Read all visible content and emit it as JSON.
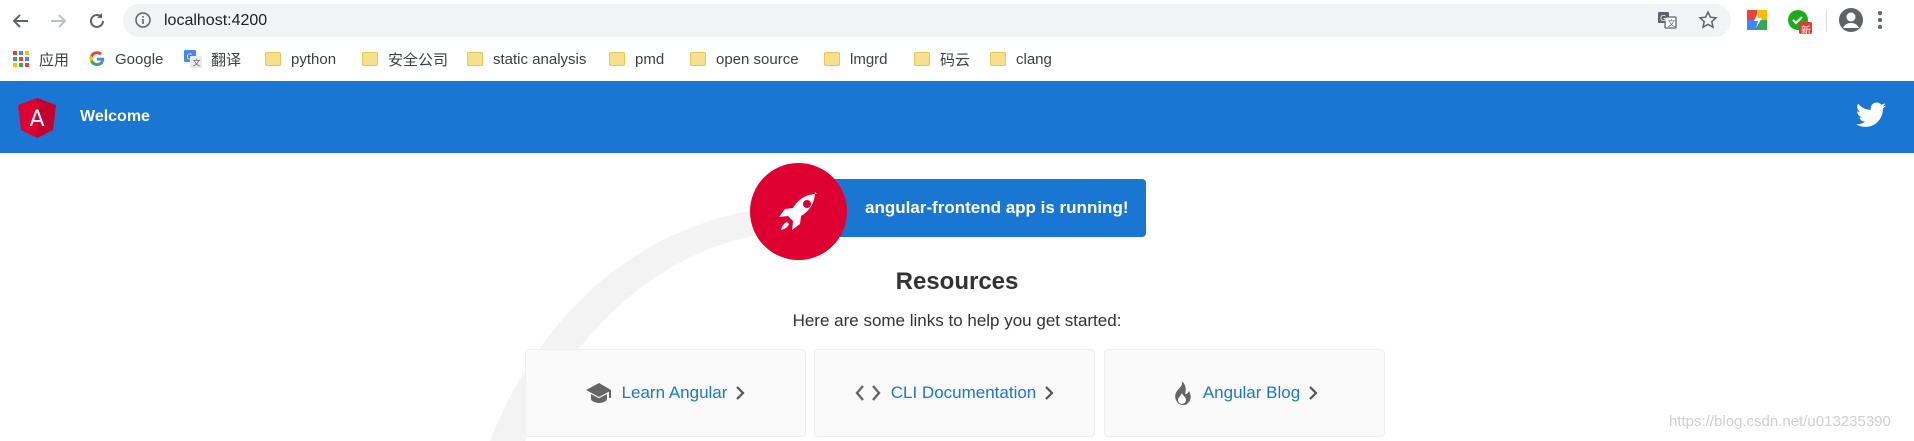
{
  "browser": {
    "url": "localhost:4200",
    "bookmarks": [
      {
        "label": "应用",
        "icon": "apps-grid-icon"
      },
      {
        "label": "Google",
        "icon": "google-icon"
      },
      {
        "label": "翻译",
        "icon": "translate-icon"
      },
      {
        "label": "python",
        "icon": "folder-icon"
      },
      {
        "label": "安全公司",
        "icon": "folder-icon"
      },
      {
        "label": "static analysis",
        "icon": "folder-icon"
      },
      {
        "label": "pmd",
        "icon": "folder-icon"
      },
      {
        "label": "open source",
        "icon": "folder-icon"
      },
      {
        "label": "lmgrd",
        "icon": "folder-icon"
      },
      {
        "label": "码云",
        "icon": "folder-icon"
      },
      {
        "label": "clang",
        "icon": "folder-icon"
      }
    ],
    "extension_badge": "新"
  },
  "app": {
    "header": {
      "title": "Welcome",
      "logo_letter": "A"
    },
    "status_card": "angular-frontend app is running!",
    "resources_title": "Resources",
    "resources_subtitle": "Here are some links to help you get started:",
    "resources": [
      {
        "label": "Learn Angular",
        "icon": "graduation-cap-icon"
      },
      {
        "label": "CLI Documentation",
        "icon": "code-brackets-icon"
      },
      {
        "label": "Angular Blog",
        "icon": "flame-icon"
      }
    ]
  },
  "watermark": "https://blog.csdn.net/u013235390",
  "colors": {
    "brand_blue": "#1976d2",
    "angular_red": "#dd0031"
  }
}
